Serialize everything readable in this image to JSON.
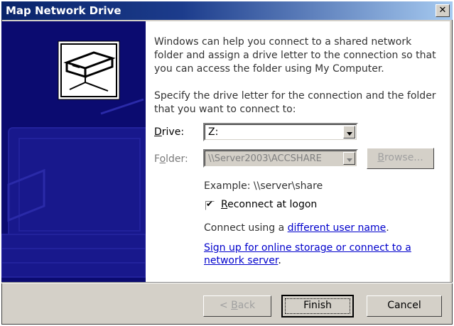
{
  "window": {
    "title": "Map Network Drive",
    "close_symbol": "✕"
  },
  "intro": {
    "text": "Windows can help you connect to a shared network folder and assign a drive letter to the connection so that you can access the folder using My Computer."
  },
  "instructions": {
    "text": "Specify the drive letter for the connection and the folder that you want to connect to:"
  },
  "drive": {
    "label_mnemonic": "D",
    "label_rest": "rive:",
    "value": "Z:"
  },
  "folder": {
    "label_pre": "F",
    "label_mnemonic": "o",
    "label_rest": "lder:",
    "value": "\\\\Server2003\\ACCSHARE",
    "browse_mnemonic": "B",
    "browse_rest": "rowse..."
  },
  "example": {
    "text": "Example: \\\\server\\share"
  },
  "reconnect": {
    "label_mnemonic": "R",
    "label_rest": "econnect at logon",
    "checked": true
  },
  "connect_using": {
    "prefix": "Connect using a ",
    "link": "different user name",
    "suffix": "."
  },
  "signup": {
    "link_line1": "Sign up for online storage or connect to a",
    "link_line2": "network server",
    "suffix": "."
  },
  "buttons": {
    "back_prefix": "< ",
    "back_mnemonic": "B",
    "back_rest": "ack",
    "finish": "Finish",
    "cancel": "Cancel"
  },
  "icons": {
    "side_panel": "network-drive-icon",
    "close": "close-icon",
    "dropdown": "chevron-down-icon",
    "check": "checkmark-icon"
  }
}
